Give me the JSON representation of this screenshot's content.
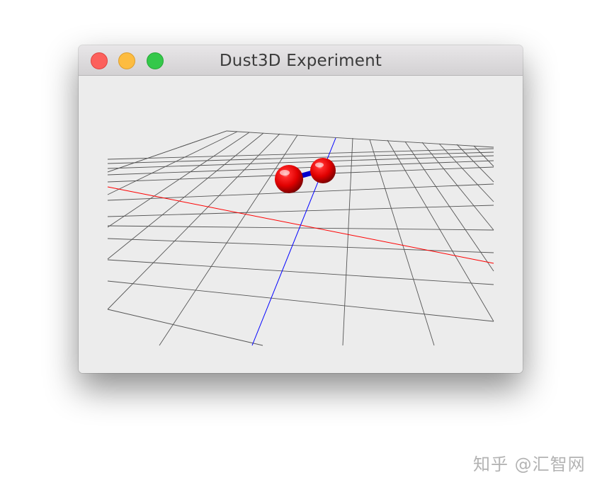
{
  "window": {
    "title": "Dust3D Experiment",
    "controls": [
      {
        "name": "close",
        "color": "#fc605c"
      },
      {
        "name": "minimize",
        "color": "#fdbc40"
      },
      {
        "name": "zoom",
        "color": "#34c84a"
      }
    ]
  },
  "viewport": {
    "background": "#ececec",
    "grid_color": "#555555",
    "x_axis_color": "#ff0000",
    "z_axis_color": "#0000ff",
    "node_color": "#ff0000",
    "edge_color": "#0000cc",
    "nodes": 2,
    "edges": 1
  },
  "watermark": {
    "text": "知乎 @汇智网"
  }
}
